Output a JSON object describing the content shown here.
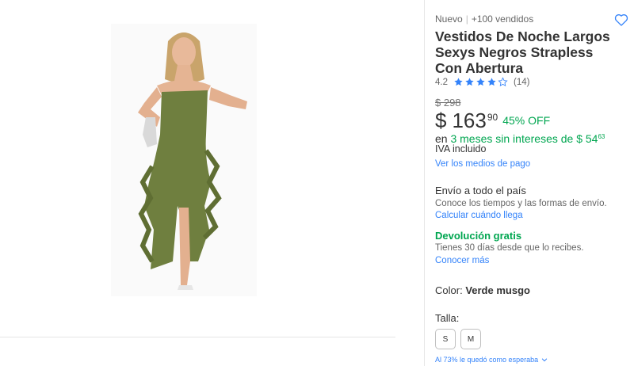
{
  "product": {
    "condition": "Nuevo",
    "separator": "|",
    "sold": "+100 vendidos",
    "title": "Vestidos De Noche Largos Sexys Negros Strapless Con Abertura",
    "rating_value": "4.2",
    "rating_stars": 4,
    "rating_count": "(14)",
    "image_alt": "product-photo"
  },
  "price": {
    "old": "$ 298",
    "currency": "$",
    "integer": "163",
    "cents": "90",
    "discount": "45% OFF",
    "installments_prefix": "en",
    "installments_highlight": "3 meses sin intereses de $ 54",
    "installments_cents": "63",
    "tax_note": "IVA incluido",
    "payment_link": "Ver los medios de pago"
  },
  "shipping": {
    "title": "Envío a todo el país",
    "subtitle": "Conoce los tiempos y las formas de envío.",
    "link": "Calcular cuándo llega"
  },
  "returns": {
    "title": "Devolución gratis",
    "subtitle": "Tienes 30 días desde que lo recibes.",
    "link": "Conocer más"
  },
  "variant": {
    "color_label": "Color:",
    "color_value": "Verde musgo",
    "size_label": "Talla:",
    "sizes": [
      "S",
      "M"
    ],
    "fit_note": "Al 73% le quedó como esperaba"
  },
  "colors": {
    "accent": "#3483fa",
    "green": "#00a650",
    "dress": "#6f7f3f",
    "text": "#333333"
  },
  "icons": {
    "favorite": "heart-icon",
    "star": "star-icon",
    "chevron": "chevron-down-icon"
  }
}
